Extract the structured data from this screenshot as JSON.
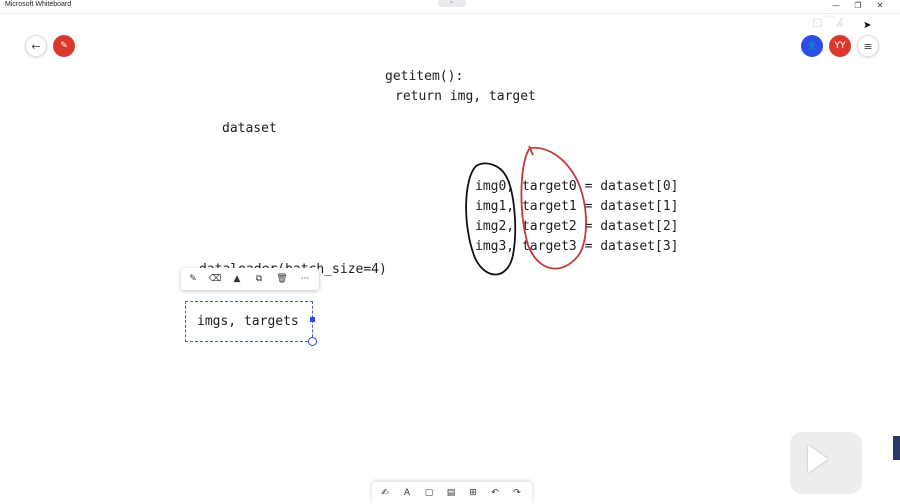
{
  "window": {
    "title": "Microsoft Whiteboard",
    "min_glyph": "—",
    "restore_glyph": "❐",
    "close_glyph": "✕",
    "handle_glyph": "⌄"
  },
  "toolbar_top": {
    "back_glyph": "←",
    "ink_glyph": "✎",
    "user_glyph": "👤",
    "avatar_initials": "YY",
    "menu_glyph": "≡"
  },
  "canvas": {
    "lines": [
      "getitem():",
      "return img, target",
      "dataset",
      "img0, target0 = dataset[0]",
      "img1, target1 = dataset[1]",
      "img2, target2 = dataset[2]",
      "img3, target3 = dataset[3]",
      "dataloader(batch_size=4)",
      "imgs, targets"
    ]
  },
  "selection_toolbar": [
    "✎",
    "⌫",
    "▲",
    "⧉",
    "🗑",
    "···"
  ],
  "bottom_toolbar": [
    "✍",
    "A",
    "▢",
    "▤",
    "⊞",
    "↶",
    "↷"
  ],
  "colors": {
    "accent_blue": "#2c4ee6",
    "accent_red": "#d9382c",
    "ink": "#202020",
    "red_lasso": "#c0393b",
    "black_lasso": "#111111"
  }
}
